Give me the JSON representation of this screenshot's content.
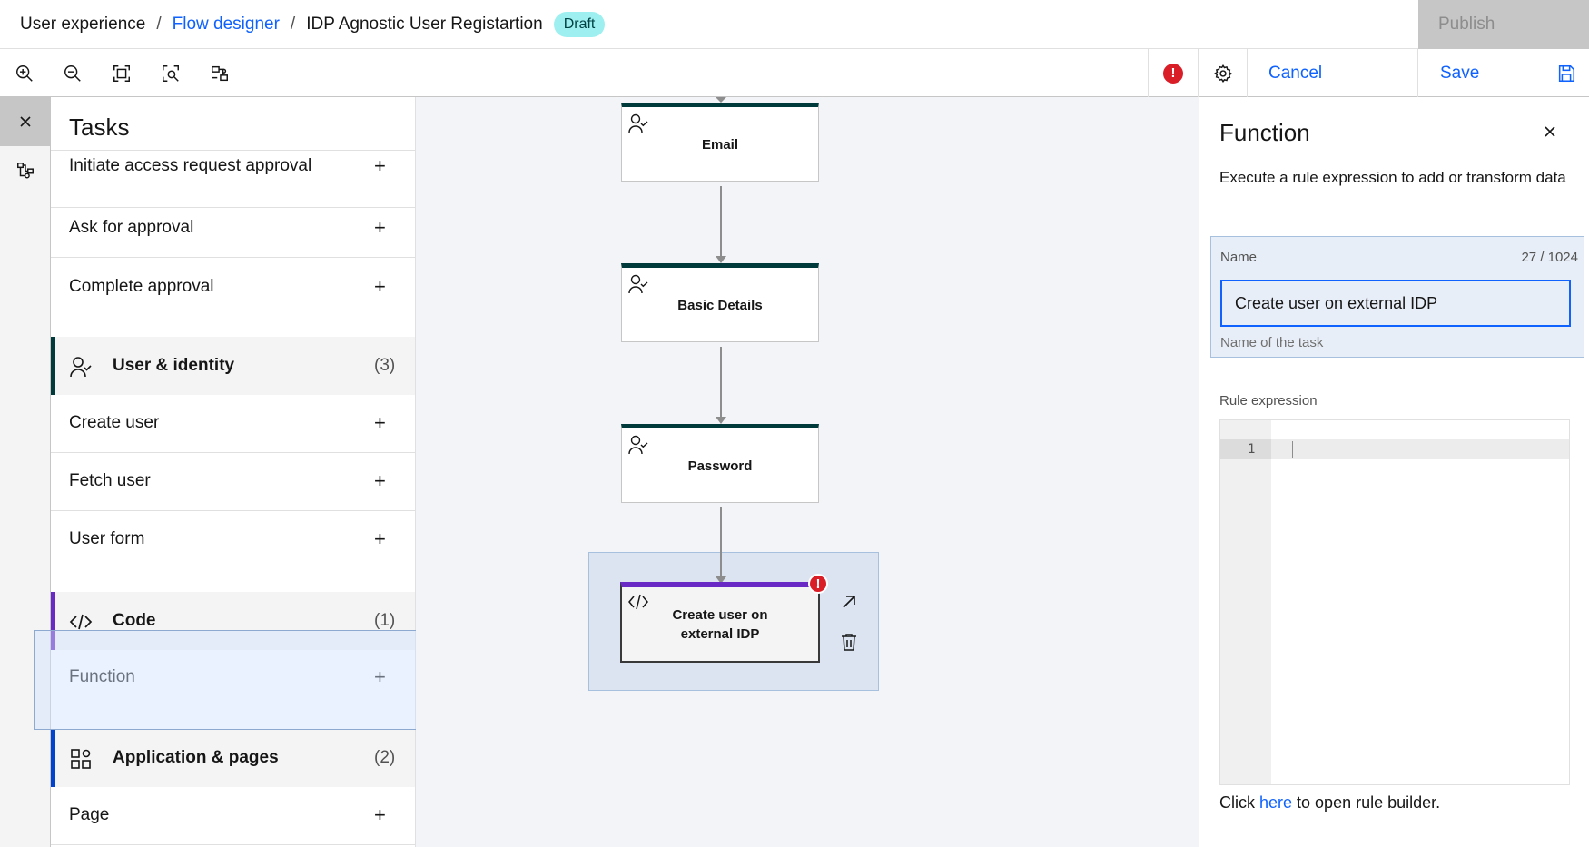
{
  "header": {
    "breadcrumb": [
      {
        "label": "User experience"
      },
      {
        "label": "Flow designer"
      }
    ],
    "current": "IDP Agnostic User Registartion",
    "badge": "Draft",
    "publish_label": "Publish"
  },
  "toolbar": {
    "tools": [
      "zoom-in-icon",
      "zoom-out-icon",
      "fit-to-screen-icon",
      "zoom-area-icon",
      "minimap-icon"
    ],
    "error_indicator": "!",
    "cancel_label": "Cancel",
    "save_label": "Save"
  },
  "tasks": {
    "title": "Tasks",
    "items_top": [
      {
        "label": "Initiate access request approval"
      },
      {
        "label": "Ask for approval"
      },
      {
        "label": "Complete approval"
      }
    ],
    "categories": [
      {
        "label": "User & identity",
        "count": "(3)",
        "color": "#003a3a",
        "items": [
          "Create user",
          "Fetch user",
          "User form"
        ]
      },
      {
        "label": "Code",
        "count": "(1)",
        "color": "#6929c4",
        "items": [
          "Function"
        ]
      },
      {
        "label": "Application & pages",
        "count": "(2)",
        "color": "#0043ce",
        "items": [
          "Page"
        ]
      }
    ],
    "add_symbol": "+"
  },
  "canvas": {
    "nodes": [
      {
        "label": "Email"
      },
      {
        "label": "Basic Details"
      },
      {
        "label": "Password"
      }
    ],
    "selected_node": {
      "label": "Create user on external IDP",
      "error": "!"
    }
  },
  "props": {
    "title": "Function",
    "description": "Execute a rule expression to add or transform data",
    "name_label": "Name",
    "name_count": "27 / 1024",
    "name_value": "Create user on external IDP",
    "name_helper": "Name of the task",
    "rule_label": "Rule expression",
    "line_number": "1",
    "link_prefix": "Click ",
    "link_text": "here",
    "link_suffix": " to open rule builder."
  }
}
